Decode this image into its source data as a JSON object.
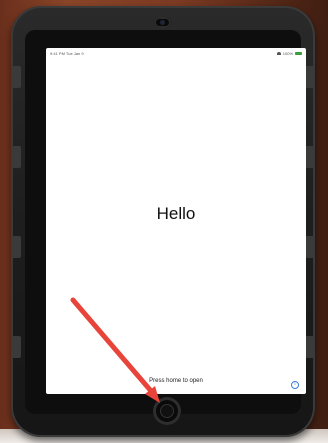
{
  "status_bar": {
    "time_date": "9:41 PM  Tue Jan 9",
    "battery": "100%",
    "battery_level": 1.0
  },
  "lock_screen": {
    "greeting": "Hello",
    "home_hint": "Press home to open"
  },
  "icons": {
    "info": "info-icon",
    "arrow": "arrow-icon"
  },
  "colors": {
    "arrow": "#e8443a",
    "battery": "#3aa33a",
    "info": "#3a7bd5"
  }
}
